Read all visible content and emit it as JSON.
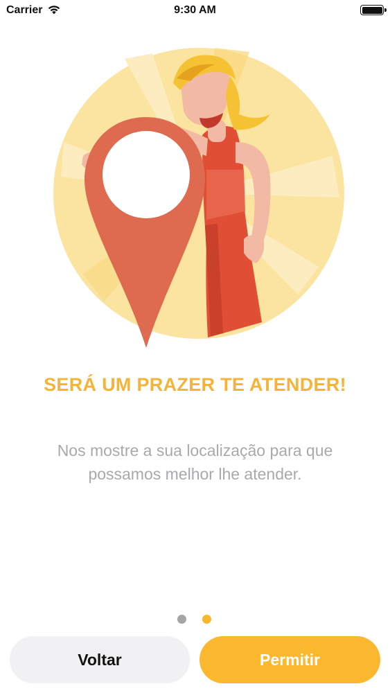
{
  "status_bar": {
    "carrier": "Carrier",
    "time": "9:30 AM"
  },
  "onboarding": {
    "title": "SERÁ UM PRAZER TE ATENDER!",
    "subtitle": "Nos mostre a sua localização para que possamos melhor lhe atender.",
    "illustration_icon": "location-pin-woman-illustration",
    "pager": {
      "total": 2,
      "current": 2
    }
  },
  "buttons": {
    "back_label": "Voltar",
    "allow_label": "Permitir"
  },
  "colors": {
    "accent": "#fbb72e",
    "title": "#f4b43a",
    "text_muted": "#a9a9ad",
    "pin": "#dd6a4e",
    "secondary_button": "#f1f1f4"
  }
}
